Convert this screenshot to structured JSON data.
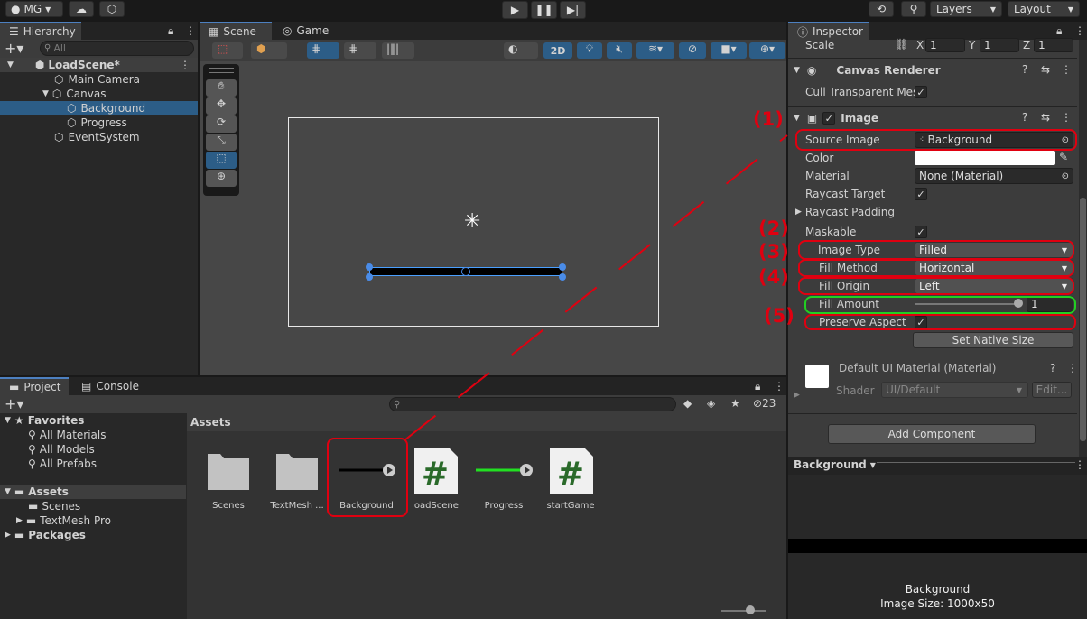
{
  "toolbar": {
    "account": "MG",
    "layers": "Layers",
    "layout": "Layout"
  },
  "hierarchy": {
    "tab": "Hierarchy",
    "search_placeholder": "All",
    "scene": "LoadScene*",
    "items": [
      "Main Camera",
      "Canvas",
      "Background",
      "Progress",
      "EventSystem"
    ]
  },
  "scene_view": {
    "tab_scene": "Scene",
    "tab_game": "Game",
    "btn_2d": "2D"
  },
  "inspector": {
    "tab": "Inspector",
    "scale_label": "Scale",
    "scale": {
      "x_label": "X",
      "x": "1",
      "y_label": "Y",
      "y": "1",
      "z_label": "Z",
      "z": "1"
    },
    "canvas_renderer": "Canvas Renderer",
    "cull_transparent": "Cull Transparent Mes",
    "image_component": "Image",
    "source_image_label": "Source Image",
    "source_image": "Background",
    "color_label": "Color",
    "material_label": "Material",
    "material": "None (Material)",
    "raycast_target": "Raycast Target",
    "raycast_padding": "Raycast Padding",
    "maskable": "Maskable",
    "image_type_label": "Image Type",
    "image_type": "Filled",
    "fill_method_label": "Fill Method",
    "fill_method": "Horizontal",
    "fill_origin_label": "Fill Origin",
    "fill_origin": "Left",
    "fill_amount_label": "Fill Amount",
    "fill_amount": "1",
    "fill_amount_level": 1.0,
    "preserve_aspect": "Preserve Aspect",
    "set_native_size": "Set Native Size",
    "material_block_title": "Default UI Material (Material)",
    "shader_label": "Shader",
    "shader": "UI/Default",
    "edit": "Edit...",
    "add_component": "Add Component",
    "preview_dropdown": "Background",
    "preview_name": "Background",
    "preview_size": "Image Size: 1000x50"
  },
  "annotations": [
    "(1)",
    "(2)",
    "(3)",
    "(4)",
    "(5)"
  ],
  "project": {
    "tab_project": "Project",
    "tab_console": "Console",
    "hidden_count": "23",
    "favorites": "Favorites",
    "favorite_items": [
      "All Materials",
      "All Models",
      "All Prefabs"
    ],
    "assets": "Assets",
    "asset_folders": [
      "Scenes",
      "TextMesh Pro"
    ],
    "packages": "Packages",
    "breadcrumb": "Assets",
    "grid_items": [
      "Scenes",
      "TextMesh ...",
      "Background",
      "loadScene",
      "Progress",
      "startGame"
    ]
  },
  "colors": {
    "annotation_red": "#e00010",
    "annotation_green": "#22d022",
    "selection_blue": "#2c5d87",
    "script_green": "#2a6a2a"
  }
}
